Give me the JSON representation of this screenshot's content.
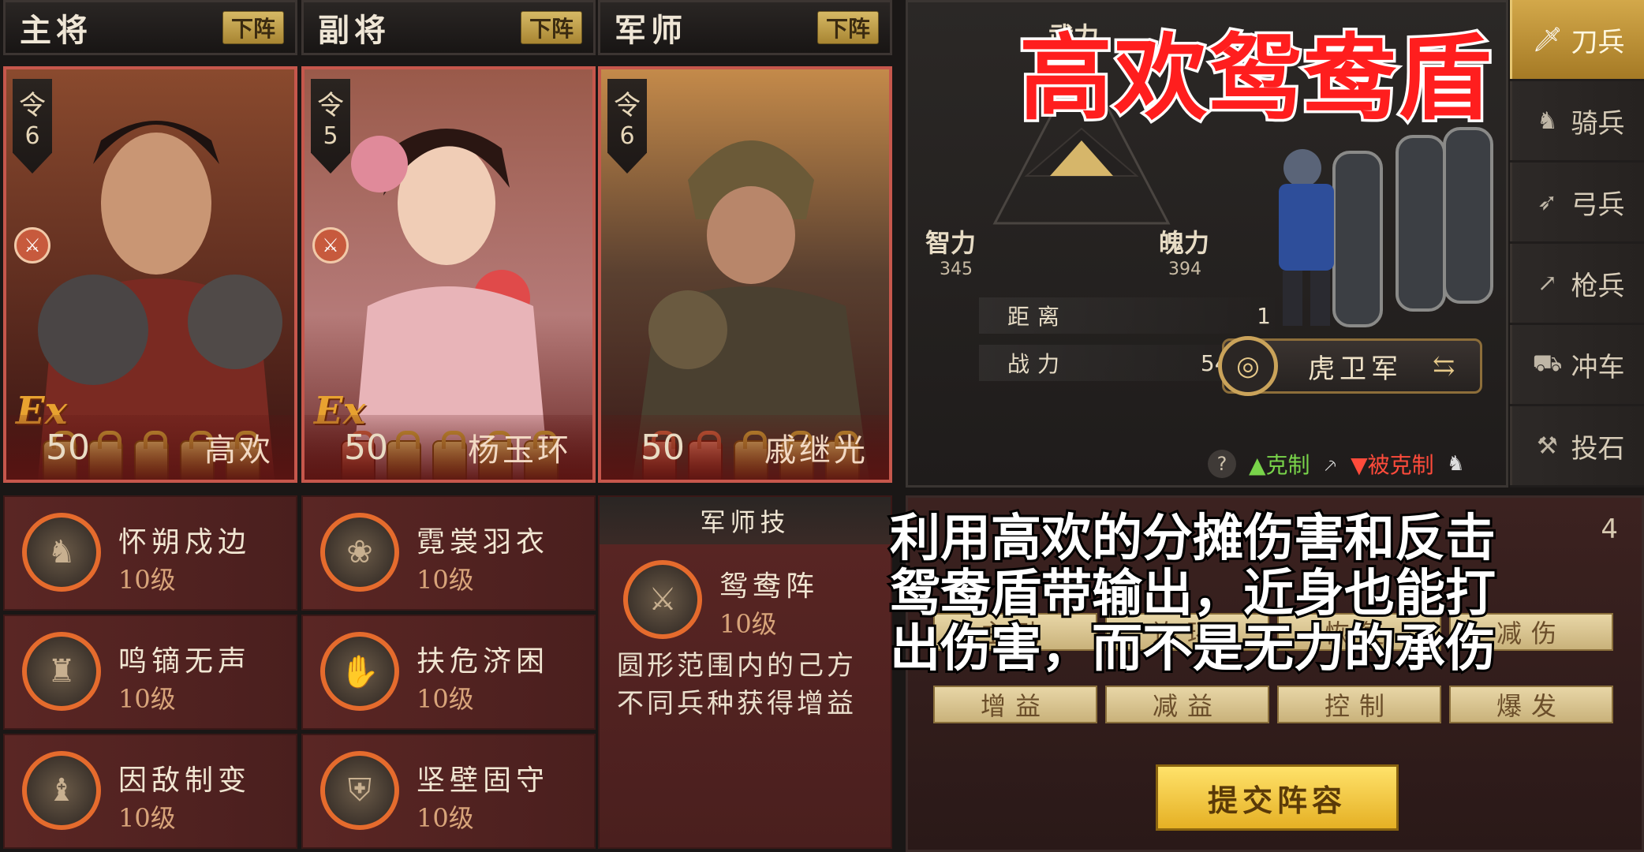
{
  "heroes": [
    {
      "role": "主将",
      "off_label": "下阵",
      "ling": "令",
      "cost": "6",
      "level": "50",
      "name": "高欢",
      "ex": "Ex",
      "locks": [
        "gold",
        "gold",
        "gold",
        "gold",
        "gold"
      ],
      "weapon_icon": "saber-icon"
    },
    {
      "role": "副将",
      "off_label": "下阵",
      "ling": "令",
      "cost": "5",
      "level": "50",
      "name": "杨玉环",
      "ex": "Ex",
      "locks": [
        "red",
        "gold",
        "gold",
        "gold",
        "gold"
      ],
      "weapon_icon": "saber-icon"
    },
    {
      "role": "军师",
      "off_label": "下阵",
      "ling": "令",
      "cost": "6",
      "level": "50",
      "name": "戚继光",
      "ex": "",
      "locks": [
        "red",
        "red",
        "gold",
        "gold",
        "gold"
      ],
      "weapon_icon": ""
    }
  ],
  "skills_main": [
    {
      "name": "怀朔戍边",
      "level": "10级"
    },
    {
      "name": "鸣镝无声",
      "level": "10级"
    },
    {
      "name": "因敌制变",
      "level": "10级"
    }
  ],
  "skills_vice": [
    {
      "name": "霓裳羽衣",
      "level": "10级"
    },
    {
      "name": "扶危济困",
      "level": "10级"
    },
    {
      "name": "坚壁固守",
      "level": "10级"
    }
  ],
  "army_skill": {
    "header": "军师技",
    "name": "鸳鸯阵",
    "level": "10级",
    "desc": "圆形范围内的己方不同兵种获得增益"
  },
  "stats": {
    "wuli": "武力",
    "zhili": "智力",
    "zhili_val": "345",
    "poli": "魄力",
    "poli_val": "394",
    "distance_label": "距离",
    "distance_val": "1",
    "power_label": "战力",
    "power_val": "54070"
  },
  "unit": {
    "name": "虎卫军"
  },
  "counter": {
    "help": "?",
    "counters": "克制",
    "countered": "被克制"
  },
  "troop_tabs": [
    {
      "label": "刀兵",
      "icon": "saber-icon",
      "active": true
    },
    {
      "label": "骑兵",
      "icon": "horse-icon",
      "active": false
    },
    {
      "label": "弓兵",
      "icon": "bow-icon",
      "active": false
    },
    {
      "label": "枪兵",
      "icon": "spear-icon",
      "active": false
    },
    {
      "label": "冲车",
      "icon": "ram-icon",
      "active": false
    },
    {
      "label": "投石",
      "icon": "catapult-icon",
      "active": false
    }
  ],
  "filters_row1": [
    "主动",
    "连环",
    "恢复",
    "减伤"
  ],
  "filters_row2": [
    "增益",
    "减益",
    "控制",
    "爆发"
  ],
  "submit_label": "提交阵容",
  "count_partial": "4",
  "overlay_title": "高欢鸳鸯盾",
  "caption_lines": [
    "利用高欢的分摊伤害和反击",
    "鸳鸯盾带输出，近身也能打",
    "出伤害，而不是无力的承伤"
  ],
  "colors": {
    "accent_gold": "#d3a84a",
    "title_red": "#ff1e1e",
    "card_border": "#c6574c"
  }
}
